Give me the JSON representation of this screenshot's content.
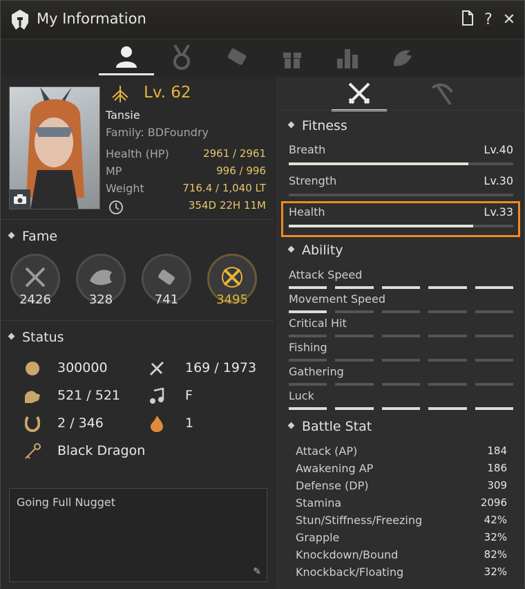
{
  "window": {
    "title": "My Information"
  },
  "title_buttons": [
    "page-icon",
    "help-icon",
    "close-icon"
  ],
  "tabs": [
    {
      "icon": "profile-icon",
      "active": true
    },
    {
      "icon": "medal-icon",
      "active": false
    },
    {
      "icon": "scroll-icon",
      "active": false
    },
    {
      "icon": "gift-icon",
      "active": false
    },
    {
      "icon": "bar-chart-icon",
      "active": false
    },
    {
      "icon": "pet-icon",
      "active": false
    }
  ],
  "character": {
    "level": "Lv. 62",
    "name": "Tansie",
    "family": "Family: BDFoundry",
    "stats": [
      {
        "label": "Health (HP)",
        "value": "2961 / 2961"
      },
      {
        "label": "MP",
        "value": "996 / 996"
      },
      {
        "label": "Weight",
        "value": "716.4 / 1,040 LT"
      },
      {
        "label": "",
        "value": "354D 22H 11M"
      }
    ]
  },
  "fame": {
    "heading": "Fame",
    "items": [
      {
        "icon": "crossed-swords-icon",
        "value": "2426",
        "highlight": false
      },
      {
        "icon": "fish-icon",
        "value": "328",
        "highlight": false
      },
      {
        "icon": "scroll-icon",
        "value": "741",
        "highlight": false
      },
      {
        "icon": "crossed-swords-gold-icon",
        "value": "3495",
        "highlight": true
      }
    ]
  },
  "status": {
    "heading": "Status",
    "items": [
      {
        "icon": "brain-icon",
        "value": "300000"
      },
      {
        "icon": "axe-icon",
        "value": "169 / 1973"
      },
      {
        "icon": "arm-icon",
        "value": "521 / 521"
      },
      {
        "icon": "music-note-icon",
        "value": "F"
      },
      {
        "icon": "horseshoe-icon",
        "value": "2 / 346"
      },
      {
        "icon": "flame-icon",
        "value": "1"
      },
      {
        "icon": "key-icon",
        "value": "Black Dragon"
      }
    ]
  },
  "motto": "Going Full Nugget",
  "right_tabs": [
    {
      "icon": "swords-icon",
      "active": true
    },
    {
      "icon": "pickaxe-icon",
      "active": false
    }
  ],
  "fitness": {
    "heading": "Fitness",
    "items": [
      {
        "label": "Breath",
        "level": "Lv.40",
        "progress": 0.8
      },
      {
        "label": "Strength",
        "level": "Lv.30",
        "progress": 0.0
      },
      {
        "label": "Health",
        "level": "Lv.33",
        "progress": 0.82,
        "highlighted": true
      }
    ]
  },
  "ability": {
    "heading": "Ability",
    "items": [
      {
        "label": "Attack Speed",
        "filled": 5
      },
      {
        "label": "Movement Speed",
        "filled": 1
      },
      {
        "label": "Critical Hit",
        "filled": 0
      },
      {
        "label": "Fishing",
        "filled": 0
      },
      {
        "label": "Gathering",
        "filled": 0
      },
      {
        "label": "Luck",
        "filled": 5
      }
    ]
  },
  "battle_stat": {
    "heading": "Battle Stat",
    "items": [
      {
        "label": "Attack (AP)",
        "value": "184"
      },
      {
        "label": "Awakening AP",
        "value": "186"
      },
      {
        "label": "Defense (DP)",
        "value": "309"
      },
      {
        "label": "Stamina",
        "value": "2096"
      },
      {
        "label": "Stun/Stiffness/Freezing",
        "value": "42%"
      },
      {
        "label": "Grapple",
        "value": "32%"
      },
      {
        "label": "Knockdown/Bound",
        "value": "82%"
      },
      {
        "label": "Knockback/Floating",
        "value": "32%"
      }
    ]
  },
  "colors": {
    "accent": "#e6b33c",
    "highlight_border": "#f08a24"
  }
}
